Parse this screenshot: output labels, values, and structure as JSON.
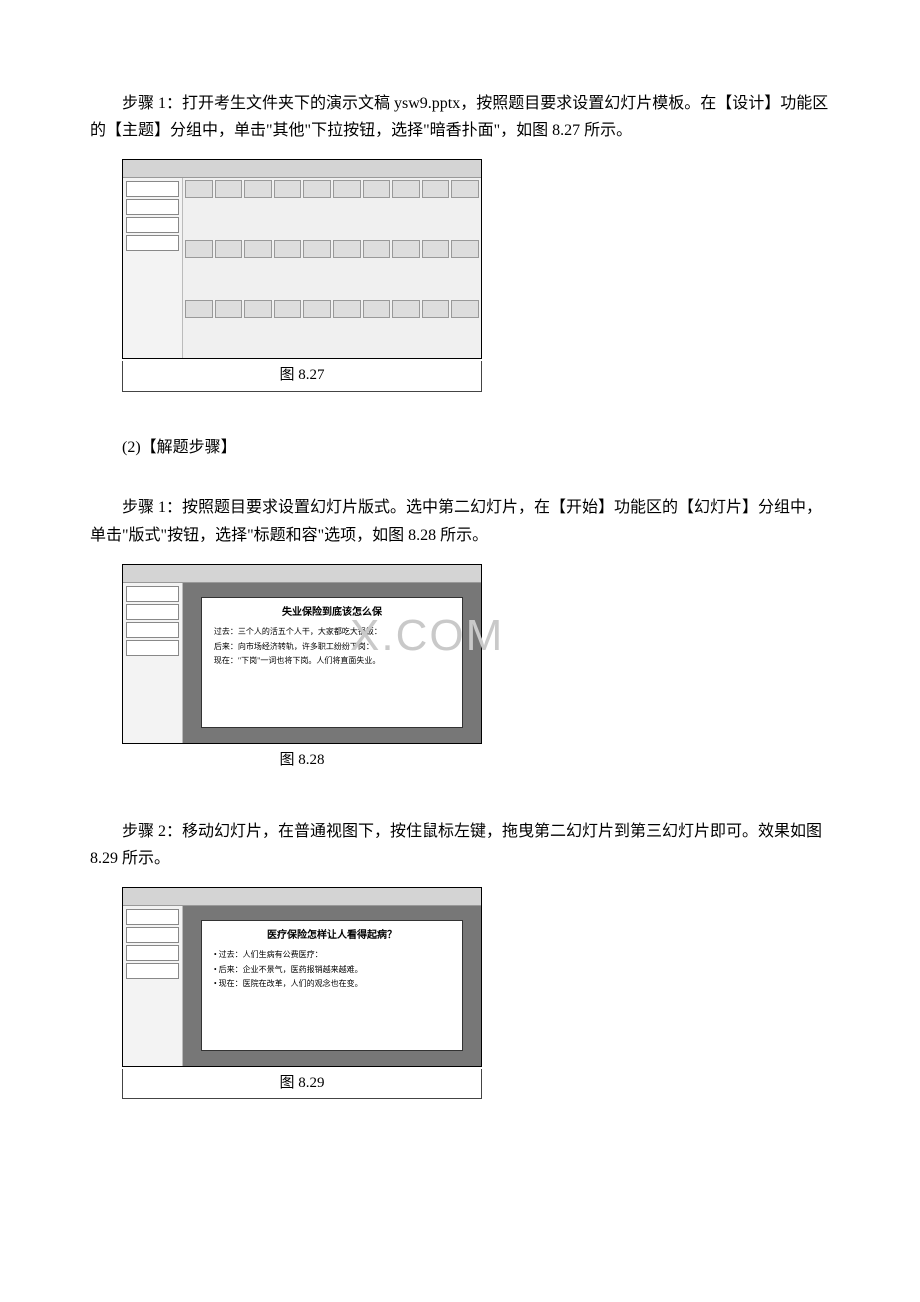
{
  "p1": "步骤 1：打开考生文件夹下的演示文稿 ysw9.pptx，按照题目要求设置幻灯片模板。在【设计】功能区的【主题】分组中，单击\"其他\"下拉按钮，选择\"暗香扑面\"，如图 8.27 所示。",
  "fig1": {
    "caption": "图 8.27"
  },
  "p2": "(2)【解题步骤】",
  "p3": "步骤 1：按照题目要求设置幻灯片版式。选中第二幻灯片，在【开始】功能区的【幻灯片】分组中，单击\"版式\"按钮，选择\"标题和容\"选项，如图 8.28 所示。",
  "fig2": {
    "caption": "图 8.28",
    "slide_title": "失业保险到底该怎么保",
    "slide_lines": [
      "过去：三个人的活五个人干，大家都吃大锅饭：",
      "后来：向市场经济转轨，许多职工纷纷下岗：",
      "现在：\"下岗\"一词也将下岗。人们将直面失业。"
    ],
    "watermark": "X.COM"
  },
  "p4": "步骤 2：移动幻灯片，在普通视图下，按住鼠标左键，拖曳第二幻灯片到第三幻灯片即可。效果如图 8.29 所示。",
  "fig3": {
    "caption": "图 8.29",
    "slide_title": "医疗保险怎样让人看得起病？",
    "slide_lines": [
      "• 过去：人们生病有公费医疗：",
      "• 后来：企业不景气，医药报销越来越难。",
      "• 现在：医院在改革，人们的观念也在变。"
    ]
  }
}
